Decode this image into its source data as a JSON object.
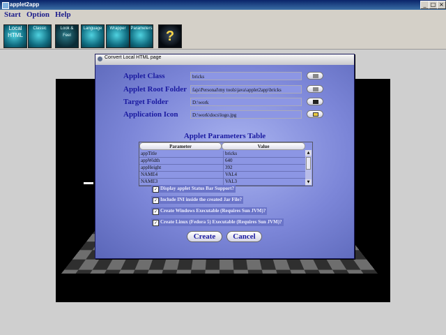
{
  "window": {
    "title": "applet2app",
    "min": "_",
    "max": "□",
    "close": "×"
  },
  "menu": [
    "Start",
    "Option",
    "Help"
  ],
  "toolbar": [
    {
      "label": "Local HTML",
      "icon": "local-html-icon"
    },
    {
      "label": "Classic",
      "icon": "classic-icon"
    },
    {
      "label": "Look & Feel",
      "icon": "look-and-feel-icon"
    },
    {
      "label": "Language",
      "icon": "language-icon"
    },
    {
      "label": "Wrapper",
      "icon": "wrapper-icon"
    },
    {
      "label": "Parameters",
      "icon": "parameters-icon"
    },
    {
      "label": "?",
      "icon": "help-icon"
    }
  ],
  "dialog": {
    "title": "Convert Local HTML page",
    "fields": [
      {
        "label": "Applet Class",
        "value": "bricks"
      },
      {
        "label": "Applet Root Folder",
        "value": "fajs\\Personal\\my tools\\java\\applet2app\\bricks"
      },
      {
        "label": "Target Folder",
        "value": "D:\\work"
      },
      {
        "label": "Application Icon",
        "value": "D:\\work\\docs\\logo.jpg"
      }
    ],
    "table": {
      "title": "Applet Parameters Table",
      "columns": [
        "Parameter",
        "Value"
      ],
      "rows": [
        [
          "appTitle",
          "bricks"
        ],
        [
          "appWidth",
          "640"
        ],
        [
          "appHeight",
          "392"
        ],
        [
          "NAME4",
          "VAL4"
        ],
        [
          "NAME3",
          "VAL3"
        ]
      ]
    },
    "options": [
      {
        "label": "Display applet Status Bar Support?",
        "checked": true
      },
      {
        "label": "Include INI inside the created Jar File?",
        "checked": true
      },
      {
        "label": "Create Windows Executable (Requires Sun JVM)?",
        "checked": true
      },
      {
        "label": "Create Linux (Fedora 5) Executable (Requires Sun JVM)?",
        "checked": true
      }
    ],
    "buttons": {
      "create": "Create",
      "cancel": "Cancel"
    }
  }
}
